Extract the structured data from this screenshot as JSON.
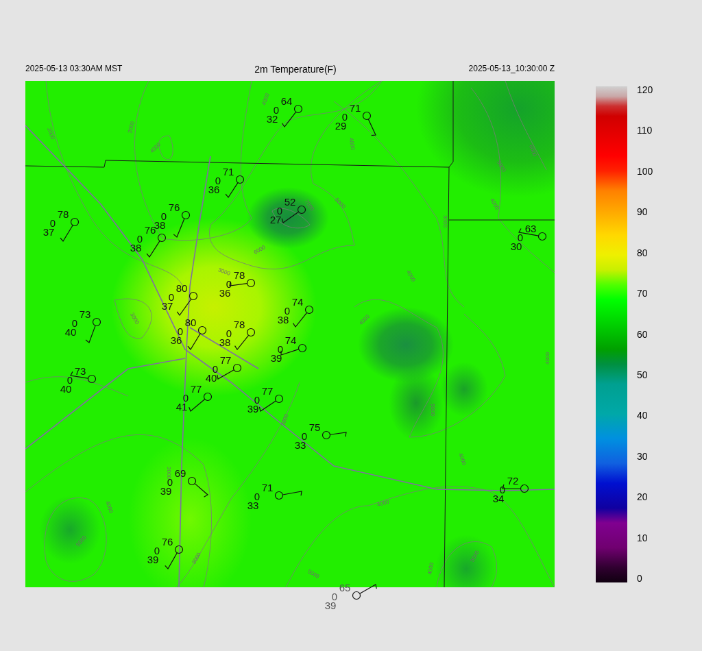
{
  "header": {
    "left": "2025-05-13 03:30AM MST",
    "title": "2m Temperature(F)",
    "right": "2025-05-13_10:30:00 Z"
  },
  "map": {
    "contour_labels": [
      "2000",
      "3000",
      "4000",
      "4000",
      "4000",
      "5000",
      "7000",
      "6000",
      "3000",
      "3000",
      "4000",
      "5000",
      "6000",
      "4000",
      "3000",
      "4000",
      "5000",
      "4000",
      "4000",
      "3000",
      "4000",
      "3000",
      "3000",
      "5000",
      "4000",
      "5000",
      "4000",
      "5000"
    ],
    "stations": [
      {
        "temperature": "64",
        "middle": "0",
        "dewpoint": "32"
      },
      {
        "temperature": "71",
        "middle": "0",
        "dewpoint": "29"
      },
      {
        "temperature": "71",
        "middle": "0",
        "dewpoint": "36"
      },
      {
        "temperature": "52",
        "middle": "0",
        "dewpoint": "27"
      },
      {
        "temperature": "78",
        "middle": "0",
        "dewpoint": "37"
      },
      {
        "temperature": "76",
        "middle": "0",
        "dewpoint": "38"
      },
      {
        "temperature": "76",
        "middle": "0",
        "dewpoint": "38"
      },
      {
        "temperature": "63",
        "middle": "0",
        "dewpoint": "30"
      },
      {
        "temperature": "78",
        "middle": "0",
        "dewpoint": "36"
      },
      {
        "temperature": "80",
        "middle": "0",
        "dewpoint": "37"
      },
      {
        "temperature": "74",
        "middle": "0",
        "dewpoint": "38"
      },
      {
        "temperature": "73",
        "middle": "0",
        "dewpoint": "40"
      },
      {
        "temperature": "80",
        "middle": "0",
        "dewpoint": "36"
      },
      {
        "temperature": "78",
        "middle": "0",
        "dewpoint": "38"
      },
      {
        "temperature": "74",
        "middle": "0",
        "dewpoint": "39"
      },
      {
        "temperature": "77",
        "middle": "0",
        "dewpoint": "40"
      },
      {
        "temperature": "73",
        "middle": "0",
        "dewpoint": "40"
      },
      {
        "temperature": "77",
        "middle": "0",
        "dewpoint": "41"
      },
      {
        "temperature": "77",
        "middle": "0",
        "dewpoint": "39"
      },
      {
        "temperature": "75",
        "middle": "0",
        "dewpoint": "33"
      },
      {
        "temperature": "69",
        "middle": "0",
        "dewpoint": "39"
      },
      {
        "temperature": "71",
        "middle": "0",
        "dewpoint": "33"
      },
      {
        "temperature": "72",
        "middle": "0",
        "dewpoint": "34"
      },
      {
        "temperature": "76",
        "middle": "0",
        "dewpoint": "39"
      },
      {
        "temperature": "65",
        "middle": "0",
        "dewpoint": "39"
      }
    ]
  },
  "colorbar": {
    "ticks": [
      "120",
      "110",
      "100",
      "90",
      "80",
      "70",
      "60",
      "50",
      "40",
      "30",
      "20",
      "10",
      "0"
    ]
  }
}
